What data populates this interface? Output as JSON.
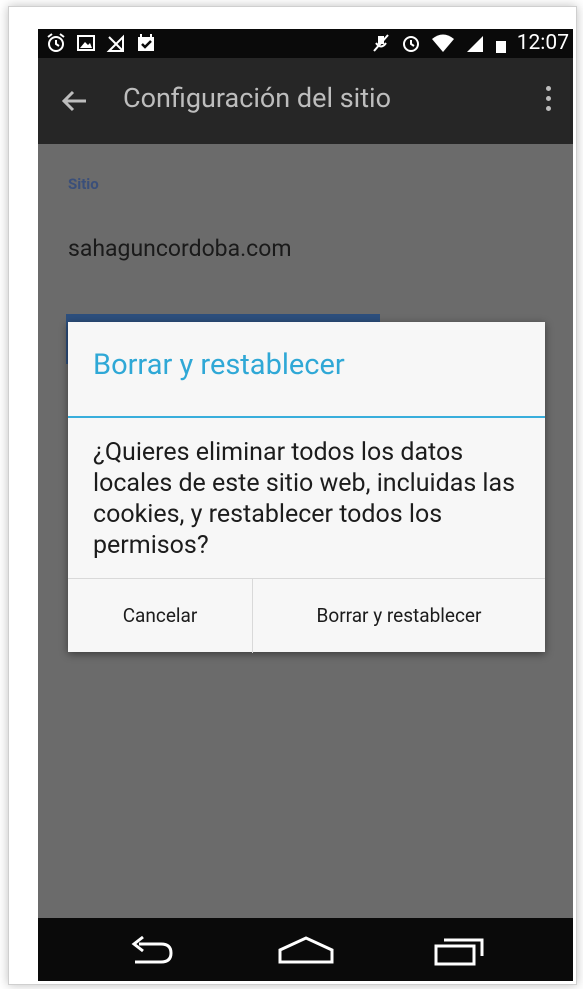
{
  "status_bar": {
    "time": "12:07",
    "left_icons": [
      "alarm-icon",
      "image-icon",
      "signal-muted-icon",
      "calendar-check-icon"
    ],
    "right_icons": [
      "mute-icon",
      "alarm-icon",
      "wifi-icon",
      "signal-icon",
      "battery-icon"
    ]
  },
  "app_bar": {
    "title": "Configuración del sitio",
    "back_icon": "arrow-back-icon",
    "menu_icon": "more-vert-icon"
  },
  "content": {
    "section_label": "Sitio",
    "site_url": "sahaguncordoba.com"
  },
  "dialog": {
    "title": "Borrar y restablecer",
    "message": "¿Quieres eliminar todos los datos locales de este sitio web, incluidas las cookies, y restablecer todos los permisos?",
    "cancel_label": "Cancelar",
    "confirm_label": "Borrar y restablecer"
  },
  "nav_bar": {
    "back": "nav-back-icon",
    "home": "nav-home-icon",
    "recents": "nav-recents-icon"
  },
  "colors": {
    "accent": "#2fa8d6",
    "section_label": "#3a4f7a",
    "scrim": "#6b6b6b",
    "app_bar": "#262626"
  }
}
